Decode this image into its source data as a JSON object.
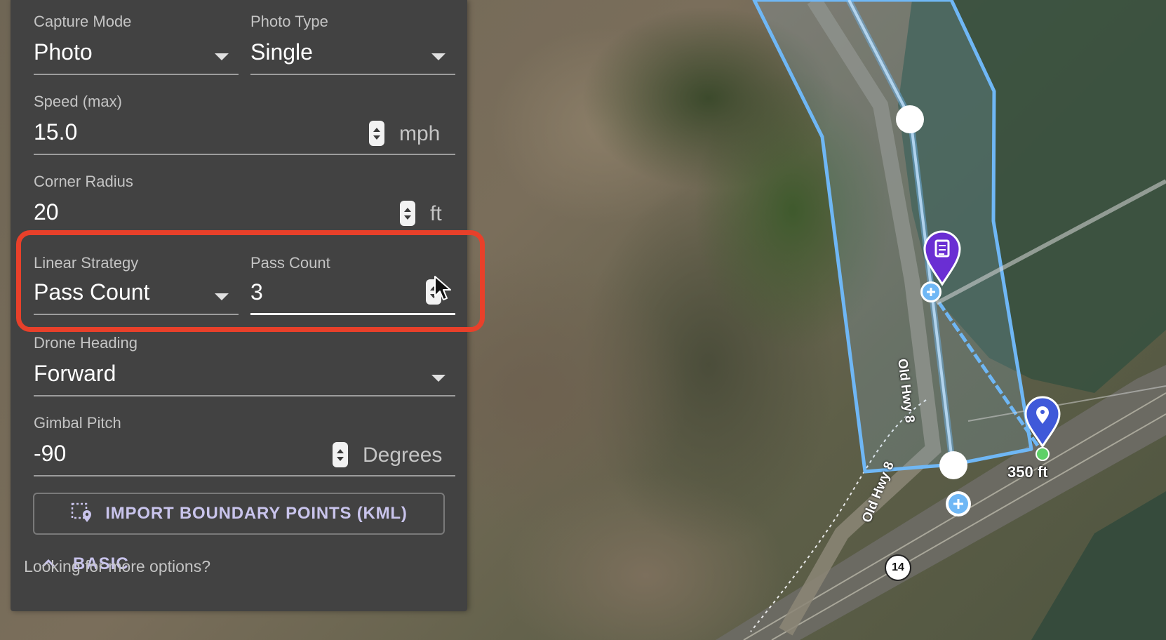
{
  "panel": {
    "fields": {
      "capture_mode": {
        "label": "Capture Mode",
        "value": "Photo"
      },
      "photo_type": {
        "label": "Photo Type",
        "value": "Single"
      },
      "speed": {
        "label": "Speed (max)",
        "value": "15.0",
        "unit": "mph"
      },
      "corner_radius": {
        "label": "Corner Radius",
        "value": "20",
        "unit": "ft"
      },
      "linear_strategy": {
        "label": "Linear Strategy",
        "value": "Pass Count"
      },
      "pass_count": {
        "label": "Pass Count",
        "value": "3"
      },
      "drone_heading": {
        "label": "Drone Heading",
        "value": "Forward"
      },
      "gimbal_pitch": {
        "label": "Gimbal Pitch",
        "value": "-90",
        "unit": "Degrees"
      }
    },
    "import_button": {
      "label": "IMPORT BOUNDARY POINTS (KML)",
      "icon": "boundary-pin-icon"
    },
    "basic_toggle": {
      "label": "BASIC",
      "icon": "chevron-up-icon"
    },
    "more_options_text": "Looking for more options?",
    "highlight_color": "#e8402a",
    "accent_color": "#c9c4ec"
  },
  "map": {
    "distance_label": "350 ft",
    "road_labels": [
      "Old Hwy 8",
      "Old Hwy 8"
    ],
    "route_badge": "14",
    "colors": {
      "boundary": "#6fb7f5",
      "waypoint_marker": "#3f59d9",
      "survey_marker": "#6a2ed3",
      "home_dot": "#5fd068"
    }
  }
}
